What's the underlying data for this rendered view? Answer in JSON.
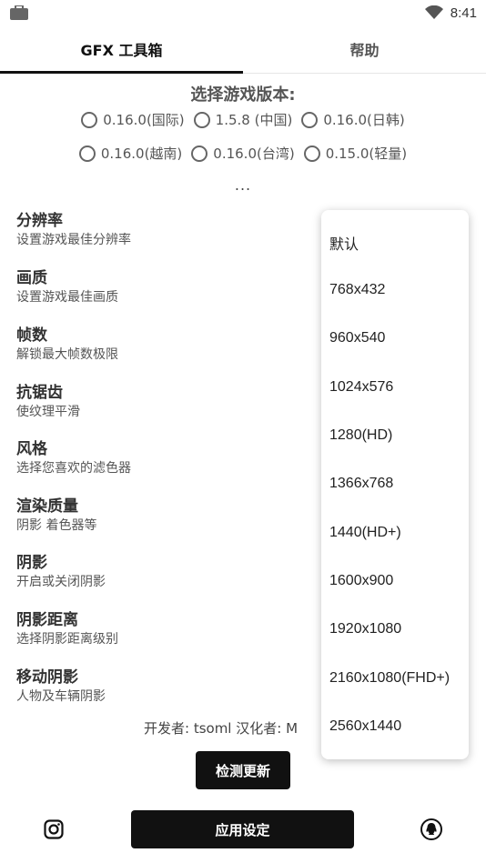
{
  "status": {
    "time": "8:41"
  },
  "tabs": [
    {
      "label": "GFX 工具箱"
    },
    {
      "label": "帮助"
    }
  ],
  "version_section": {
    "title": "选择游戏版本:",
    "options": [
      {
        "label": "0.16.0(国际)"
      },
      {
        "label": "1.5.8 (中国)"
      },
      {
        "label": "0.16.0(日韩)"
      },
      {
        "label": "0.16.0(越南)"
      },
      {
        "label": "0.16.0(台湾)"
      },
      {
        "label": "0.15.0(轻量)"
      }
    ],
    "more": "..."
  },
  "settings": [
    {
      "title": "分辨率",
      "desc": "设置游戏最佳分辨率"
    },
    {
      "title": "画质",
      "desc": "设置游戏最佳画质"
    },
    {
      "title": "帧数",
      "desc": "解锁最大帧数极限"
    },
    {
      "title": "抗锯齿",
      "desc": "使纹理平滑"
    },
    {
      "title": "风格",
      "desc": "选择您喜欢的滤色器"
    },
    {
      "title": "渲染质量",
      "desc": "阴影 着色器等"
    },
    {
      "title": "阴影",
      "desc": "开启或关闭阴影"
    },
    {
      "title": "阴影距离",
      "desc": "选择阴影距离级别"
    },
    {
      "title": "移动阴影",
      "desc": "人物及车辆阴影"
    }
  ],
  "footer": {
    "credit": "开发者: tsoml   汉化者: M",
    "check_update": "检测更新",
    "apply": "应用设定"
  },
  "dropdown": {
    "options": [
      "默认",
      "768x432",
      "960x540",
      "1024x576",
      "1280(HD)",
      "1366x768",
      "1440(HD+)",
      "1600x900",
      "1920x1080",
      "2160x1080(FHD+)",
      "2560x1440"
    ]
  }
}
